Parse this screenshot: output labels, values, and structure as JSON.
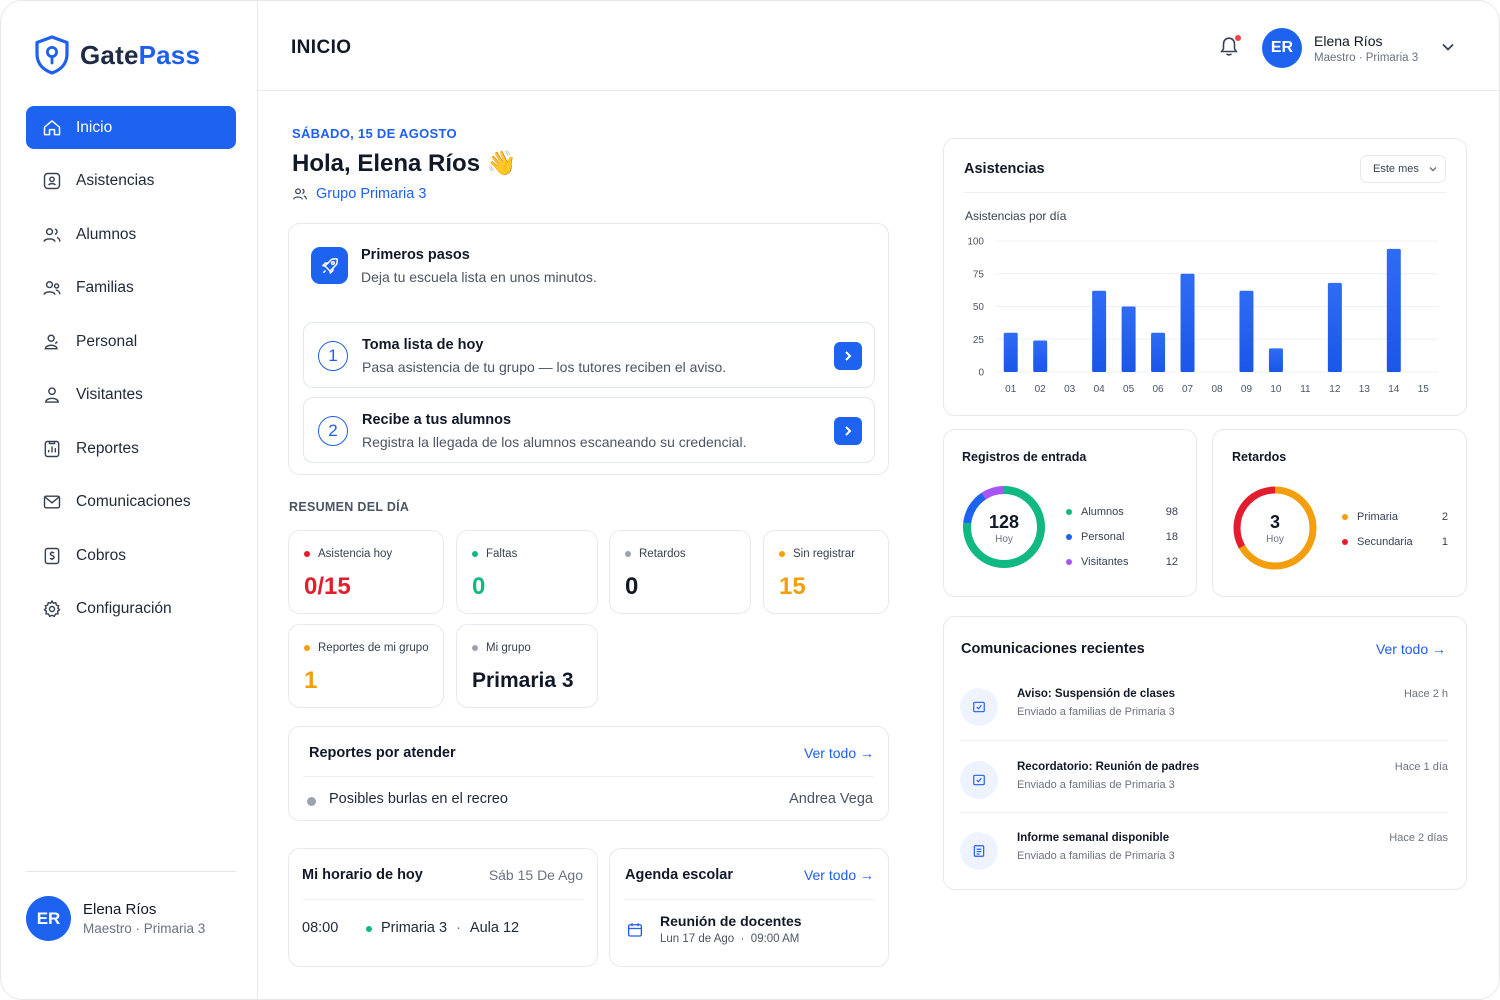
{
  "brand": {
    "part1": "Gate",
    "part2": "Pass"
  },
  "sidebar": {
    "items": [
      {
        "label": "Inicio",
        "icon": "home-icon"
      },
      {
        "label": "Asistencias",
        "icon": "qr-scan-icon"
      },
      {
        "label": "Alumnos",
        "icon": "users-icon"
      },
      {
        "label": "Familias",
        "icon": "family-icon"
      },
      {
        "label": "Personal",
        "icon": "staff-icon"
      },
      {
        "label": "Visitantes",
        "icon": "visitor-icon"
      },
      {
        "label": "Reportes",
        "icon": "report-icon"
      },
      {
        "label": "Comunicaciones",
        "icon": "mail-icon"
      },
      {
        "label": "Cobros",
        "icon": "payment-icon"
      },
      {
        "label": "Configuración",
        "icon": "gear-icon"
      }
    ],
    "user": {
      "initials": "ER",
      "name": "Elena Ríos",
      "role": "Maestro · Primaria 3"
    }
  },
  "header": {
    "title": "INICIO",
    "user": {
      "initials": "ER",
      "name": "Elena Ríos",
      "role": "Maestro · Primaria 3"
    }
  },
  "welcome": {
    "date": "SÁBADO, 15 DE AGOSTO",
    "greeting": "Hola, Elena Ríos 👋",
    "group": "Grupo Primaria 3"
  },
  "pasos": {
    "title": "Primeros pasos",
    "subtitle": "Deja tu escuela lista en unos minutos.",
    "steps": [
      {
        "num": "1",
        "title": "Toma lista de hoy",
        "desc": "Pasa asistencia de tu grupo — los tutores reciben el aviso."
      },
      {
        "num": "2",
        "title": "Recibe a tus alumnos",
        "desc": "Registra la llegada de los alumnos escaneando su credencial."
      }
    ]
  },
  "resumen": {
    "title": "RESUMEN DEL DÍA",
    "stats": [
      {
        "label": "Asistencia hoy",
        "value": "0/15",
        "color": "#e11d2e"
      },
      {
        "label": "Faltas",
        "value": "0",
        "color": "#10b981"
      },
      {
        "label": "Retardos",
        "value": "0",
        "color": "#111827",
        "dot": "#9ca3af"
      },
      {
        "label": "Sin registrar",
        "value": "15",
        "color": "#f59e0b"
      },
      {
        "label": "Reportes de mi grupo",
        "value": "1",
        "color": "#f59e0b"
      },
      {
        "label": "Mi grupo",
        "value": "Primaria 3",
        "color": "#111827",
        "dot": "#9ca3af"
      }
    ]
  },
  "reportes": {
    "title": "Reportes por atender",
    "link": "Ver todo →",
    "items": [
      {
        "text": "Posibles burlas en el recreo",
        "author": "Andrea Vega"
      }
    ]
  },
  "horario": {
    "title": "Mi horario de hoy",
    "date": "Sáb 15 De Ago",
    "time": "08:00",
    "group": "Primaria 3",
    "sep": "·",
    "room": "Aula 12"
  },
  "agenda": {
    "title": "Agenda escolar",
    "link": "Ver todo →",
    "event": "Reunión de docentes",
    "when": "Lun 17 de Ago  ·  09:00 AM"
  },
  "asistencias": {
    "title": "Asistencias",
    "filter": "Este mes",
    "subtitle": "Asistencias por día"
  },
  "chart_data": {
    "type": "bar",
    "title": "Asistencias por día",
    "categories": [
      "01",
      "02",
      "03",
      "04",
      "05",
      "06",
      "07",
      "08",
      "09",
      "10",
      "11",
      "12",
      "13",
      "14",
      "15"
    ],
    "values": [
      30,
      24,
      0,
      62,
      50,
      30,
      75,
      0,
      62,
      18,
      0,
      68,
      0,
      94,
      0
    ],
    "ylim": [
      0,
      100
    ],
    "yticks": [
      0,
      25,
      50,
      75,
      100
    ],
    "color": "#1e63f0",
    "grid": true
  },
  "registros": {
    "title": "Registros de entrada",
    "total": "128",
    "total_label": "Hoy",
    "legend": [
      {
        "label": "Alumnos",
        "value": "98",
        "color": "#10b981"
      },
      {
        "label": "Personal",
        "value": "18",
        "color": "#1e63f0"
      },
      {
        "label": "Visitantes",
        "value": "12",
        "color": "#a855f7"
      }
    ]
  },
  "retardos": {
    "title": "Retardos",
    "total": "3",
    "total_label": "Hoy",
    "legend": [
      {
        "label": "Primaria",
        "value": "2",
        "color": "#f59e0b"
      },
      {
        "label": "Secundaria",
        "value": "1",
        "color": "#e11d2e"
      }
    ]
  },
  "comunicaciones": {
    "title": "Comunicaciones recientes",
    "link": "Ver todo →",
    "items": [
      {
        "title": "Aviso: Suspensión de clases",
        "sub": "Enviado a familias de Primaria 3",
        "when": "Hace 2 h",
        "icon": "mail-check-icon"
      },
      {
        "title": "Recordatorio: Reunión de padres",
        "sub": "Enviado a familias de Primaria 3",
        "when": "Hace 1 día",
        "icon": "mail-check-icon"
      },
      {
        "title": "Informe semanal disponible",
        "sub": "Enviado a familias de Primaria 3",
        "when": "Hace 2 días",
        "icon": "document-icon"
      }
    ]
  }
}
